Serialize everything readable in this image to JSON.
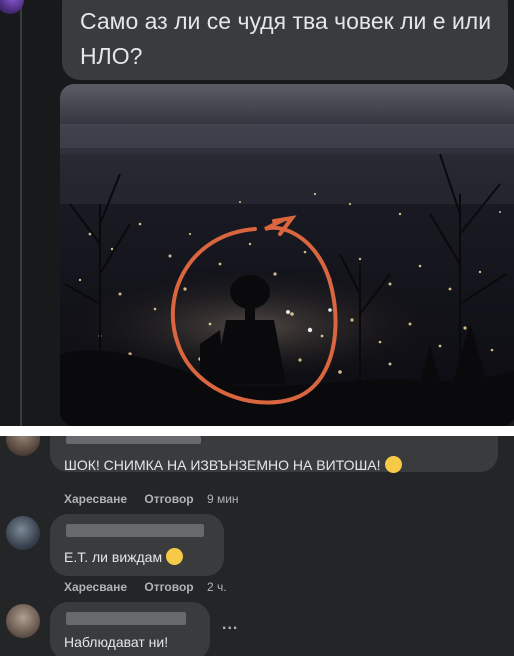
{
  "post": {
    "text": "Само аз ли се чудя тва човек ли е или НЛО?",
    "photo_icon": "city-night-alien-photo"
  },
  "comments": [
    {
      "text": "ШОК! СНИМКА НА ИЗВЪНЗЕМНО НА ВИТОША!",
      "emoji": "laughing-emoji",
      "like_label": "Харесване",
      "reply_label": "Отговор",
      "time": "9 мин"
    },
    {
      "text": "Е.Т. ли виждам",
      "emoji": "dizzy-emoji",
      "like_label": "Харесване",
      "reply_label": "Отговор",
      "time": "2 ч."
    },
    {
      "text": "Наблюдават ни!",
      "more_label": "..."
    }
  ],
  "colors": {
    "post_background": "#18191a",
    "comments_background": "#242526",
    "bubble": "#3a3b3c",
    "text": "#e4e6eb",
    "secondary_text": "#b0b3b8",
    "circle_annotation": "#d9663f"
  }
}
